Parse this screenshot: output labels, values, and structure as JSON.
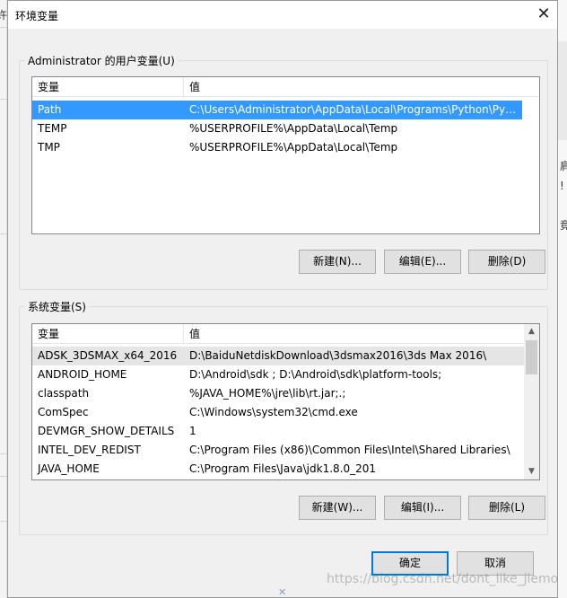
{
  "window": {
    "title": "环境变量",
    "close_glyph": "✕"
  },
  "user_vars": {
    "group_label": "Administrator 的用户变量(U)",
    "columns": [
      "变量",
      "值"
    ],
    "rows": [
      {
        "name": "Path",
        "value": "C:\\Users\\Administrator\\AppData\\Local\\Programs\\Python\\Pyt...",
        "selected": true
      },
      {
        "name": "TEMP",
        "value": "%USERPROFILE%\\AppData\\Local\\Temp",
        "selected": false
      },
      {
        "name": "TMP",
        "value": "%USERPROFILE%\\AppData\\Local\\Temp",
        "selected": false
      }
    ],
    "buttons": {
      "new": "新建(N)...",
      "edit": "编辑(E)...",
      "delete": "删除(D)"
    }
  },
  "system_vars": {
    "group_label": "系统变量(S)",
    "columns": [
      "变量",
      "值"
    ],
    "rows": [
      {
        "name": "ADSK_3DSMAX_x64_2016",
        "value": "D:\\BaiduNetdiskDownload\\3dsmax2016\\3ds Max 2016\\",
        "hover": true
      },
      {
        "name": "ANDROID_HOME",
        "value": "D:\\Android\\sdk ; D:\\Android\\sdk\\platform-tools;",
        "hover": false
      },
      {
        "name": "classpath",
        "value": "%JAVA_HOME%\\jre\\lib\\rt.jar;.;",
        "hover": false
      },
      {
        "name": "ComSpec",
        "value": "C:\\Windows\\system32\\cmd.exe",
        "hover": false
      },
      {
        "name": "DEVMGR_SHOW_DETAILS",
        "value": "1",
        "hover": false
      },
      {
        "name": "INTEL_DEV_REDIST",
        "value": "C:\\Program Files (x86)\\Common Files\\Intel\\Shared Libraries\\",
        "hover": false
      },
      {
        "name": "JAVA_HOME",
        "value": "C:\\Program Files\\Java\\jdk1.8.0_201",
        "hover": false
      }
    ],
    "buttons": {
      "new": "新建(W)...",
      "edit": "编辑(I)...",
      "delete": "删除(L)"
    }
  },
  "footer": {
    "ok": "确定",
    "cancel": "取消"
  },
  "background": {
    "left_char": "许",
    "right_chars": [
      "肩",
      "!",
      "竟"
    ]
  },
  "watermark": "https://blog.csdn.net/dont_like_jiemo"
}
